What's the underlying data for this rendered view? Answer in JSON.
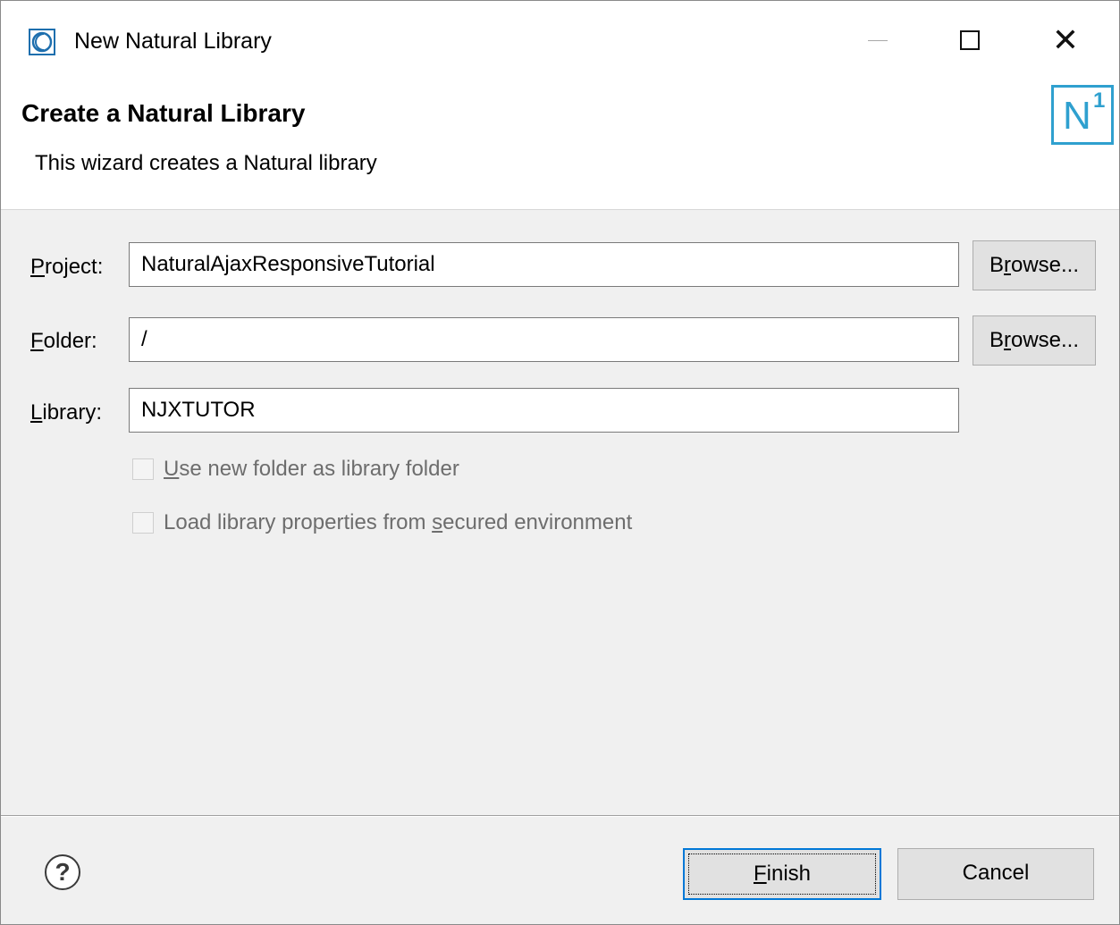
{
  "window": {
    "title": "New Natural Library",
    "icon": "eclipse-app-icon",
    "controls": {
      "minimize": "minimize-icon",
      "maximize": "maximize-icon",
      "close": "close-icon"
    }
  },
  "header": {
    "title": "Create a Natural Library",
    "description": "This wizard creates a Natural library",
    "logo_letter": "N",
    "logo_superscript": "1",
    "logo_color": "#2fa0cf"
  },
  "form": {
    "project": {
      "mnemonic": "P",
      "label_rest": "roject:",
      "value": "NaturalAjaxResponsiveTutorial",
      "browse_pre": "B",
      "browse_mnemonic": "r",
      "browse_post": "owse..."
    },
    "folder": {
      "mnemonic": "F",
      "label_rest": "older:",
      "value": "/",
      "browse_pre": "B",
      "browse_mnemonic": "r",
      "browse_post": "owse..."
    },
    "library": {
      "mnemonic": "L",
      "label_rest": "ibrary:",
      "value": "NJXTUTOR"
    },
    "use_new_folder": {
      "mnemonic": "U",
      "label_rest": "se new folder as library folder",
      "checked": false,
      "enabled": false
    },
    "load_properties": {
      "label_pre": "Load library properties from ",
      "mnemonic": "s",
      "label_post": "ecured environment",
      "checked": false,
      "enabled": false
    }
  },
  "footer": {
    "help_symbol": "?",
    "finish": {
      "mnemonic": "F",
      "label_rest": "inish"
    },
    "cancel": {
      "label": "Cancel"
    },
    "focus_color": "#0078d7"
  }
}
